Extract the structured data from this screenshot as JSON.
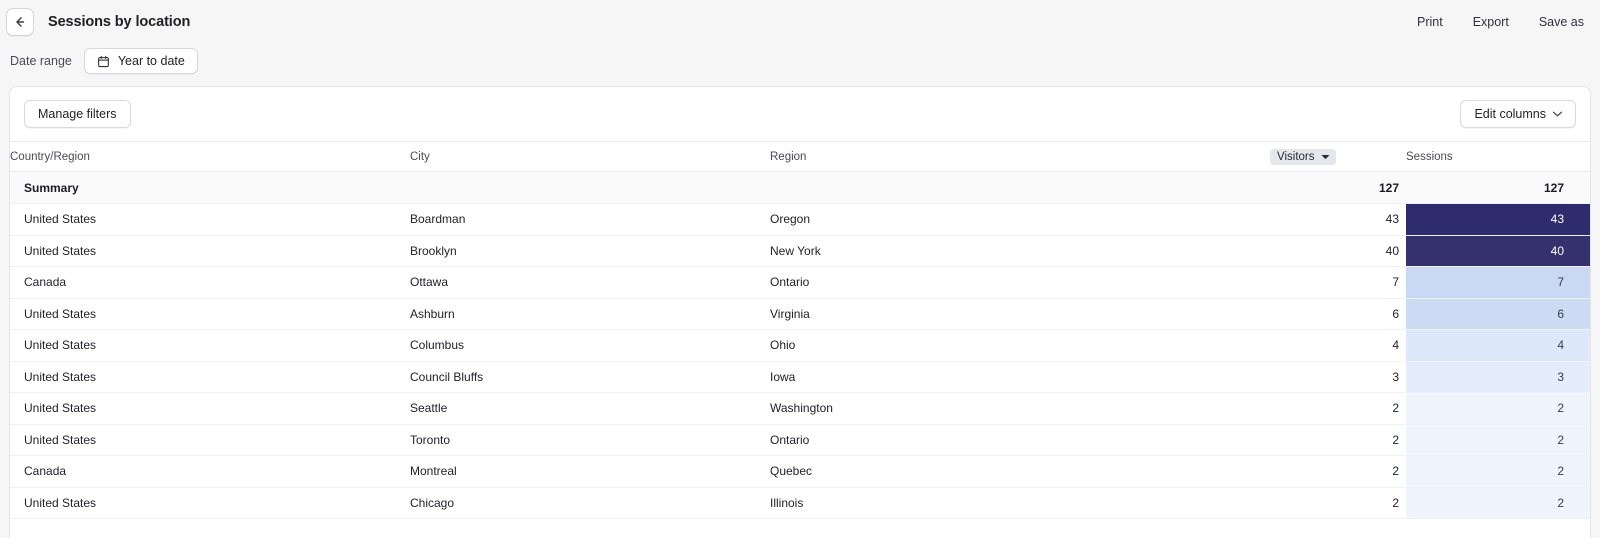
{
  "header": {
    "back_icon": "arrow-left-icon",
    "title": "Sessions by location",
    "actions": [
      {
        "label": "Print",
        "name": "print"
      },
      {
        "label": "Export",
        "name": "export"
      },
      {
        "label": "Save as",
        "name": "save-as"
      }
    ]
  },
  "date_range": {
    "label": "Date range",
    "icon": "calendar-icon",
    "value": "Year to date"
  },
  "toolbar": {
    "manage_filters_label": "Manage filters",
    "edit_columns_label": "Edit columns",
    "edit_columns_icon": "chevron-down-icon"
  },
  "table": {
    "columns": [
      {
        "key": "country",
        "label": "Country/Region",
        "align": "left"
      },
      {
        "key": "city",
        "label": "City",
        "align": "left"
      },
      {
        "key": "region",
        "label": "Region",
        "align": "left"
      },
      {
        "key": "visitors",
        "label": "Visitors",
        "align": "right",
        "sorted": true,
        "sort_icon": "caret-down-icon"
      },
      {
        "key": "sessions",
        "label": "Sessions",
        "align": "right",
        "sorted": false
      }
    ],
    "summary": {
      "label": "Summary",
      "visitors": "127",
      "sessions": "127"
    },
    "rows": [
      {
        "country": "United States",
        "city": "Boardman",
        "region": "Oregon",
        "visitors": "43",
        "sessions": "43"
      },
      {
        "country": "United States",
        "city": "Brooklyn",
        "region": "New York",
        "visitors": "40",
        "sessions": "40"
      },
      {
        "country": "Canada",
        "city": "Ottawa",
        "region": "Ontario",
        "visitors": "7",
        "sessions": "7"
      },
      {
        "country": "United States",
        "city": "Ashburn",
        "region": "Virginia",
        "visitors": "6",
        "sessions": "6"
      },
      {
        "country": "United States",
        "city": "Columbus",
        "region": "Ohio",
        "visitors": "4",
        "sessions": "4"
      },
      {
        "country": "United States",
        "city": "Council Bluffs",
        "region": "Iowa",
        "visitors": "3",
        "sessions": "3"
      },
      {
        "country": "United States",
        "city": "Seattle",
        "region": "Washington",
        "visitors": "2",
        "sessions": "2"
      },
      {
        "country": "United States",
        "city": "Toronto",
        "region": "Ontario",
        "visitors": "2",
        "sessions": "2"
      },
      {
        "country": "Canada",
        "city": "Montreal",
        "region": "Quebec",
        "visitors": "2",
        "sessions": "2"
      },
      {
        "country": "United States",
        "city": "Chicago",
        "region": "Illinois",
        "visitors": "2",
        "sessions": "2"
      }
    ]
  },
  "chart_data": {
    "type": "table",
    "title": "Sessions by location",
    "heatmap_column": "Sessions",
    "categories": [
      "Boardman, Oregon, United States",
      "Brooklyn, New York, United States",
      "Ottawa, Ontario, Canada",
      "Ashburn, Virginia, United States",
      "Columbus, Ohio, United States",
      "Council Bluffs, Iowa, United States",
      "Seattle, Washington, United States",
      "Toronto, Ontario, United States",
      "Montreal, Quebec, Canada",
      "Chicago, Illinois, United States"
    ],
    "series": [
      {
        "name": "Visitors",
        "values": [
          43,
          40,
          7,
          6,
          4,
          3,
          2,
          2,
          2,
          2
        ]
      },
      {
        "name": "Sessions",
        "values": [
          43,
          40,
          7,
          6,
          4,
          3,
          2,
          2,
          2,
          2
        ]
      }
    ],
    "totals": {
      "Visitors": 127,
      "Sessions": 127
    },
    "heat_colors": [
      "#2e2b6e",
      "#35316f",
      "#c9d9f3",
      "#ccdaf3",
      "#dde8fa",
      "#e4edfb",
      "#eff4fd",
      "#eff4fd",
      "#eff4fd",
      "#eff4fd"
    ],
    "heat_text_colors": [
      "#ffffff",
      "#ffffff",
      "#3b3b46",
      "#3b3b46",
      "#3b3b46",
      "#3b3b46",
      "#3b3b46",
      "#3b3b46",
      "#3b3b46",
      "#3b3b46"
    ]
  }
}
